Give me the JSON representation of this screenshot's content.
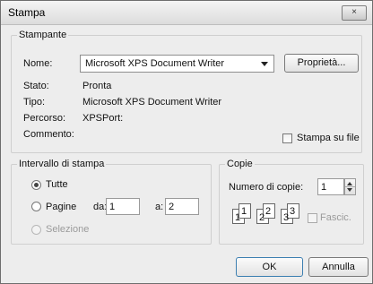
{
  "window": {
    "title": "Stampa",
    "close_label": "×"
  },
  "printer_group": {
    "legend": "Stampante",
    "name_label": "Nome:",
    "name_value": "Microsoft XPS Document Writer",
    "properties_button": "Proprietà...",
    "status_label": "Stato:",
    "status_value": "Pronta",
    "type_label": "Tipo:",
    "type_value": "Microsoft XPS Document Writer",
    "path_label": "Percorso:",
    "path_value": "XPSPort:",
    "comment_label": "Commento:",
    "print_to_file_label": "Stampa su file",
    "print_to_file_checked": false
  },
  "range_group": {
    "legend": "Intervallo di stampa",
    "all_label": "Tutte",
    "all_selected": true,
    "pages_label": "Pagine",
    "from_label": "da:",
    "from_value": "1",
    "to_label": "a:",
    "to_value": "2",
    "selection_label": "Selezione"
  },
  "copies_group": {
    "legend": "Copie",
    "count_label": "Numero di copie:",
    "count_value": "1",
    "collate_label": "Fascic.",
    "collate_checked": false,
    "collate_pages": [
      "1",
      "1",
      "2",
      "2",
      "3",
      "3"
    ]
  },
  "buttons": {
    "ok": "OK",
    "cancel": "Annulla"
  }
}
